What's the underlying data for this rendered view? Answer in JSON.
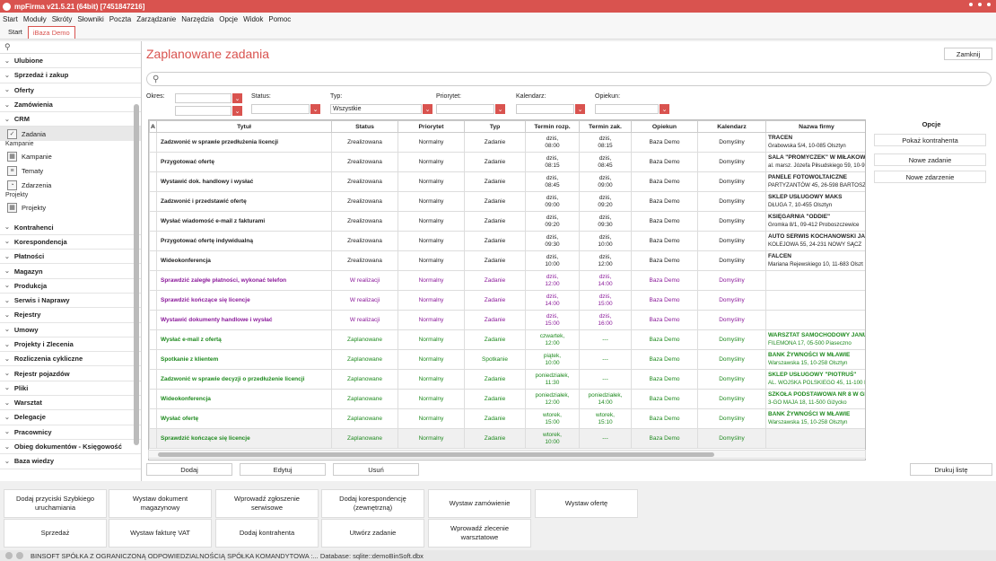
{
  "window": {
    "title": "mpFirma v21.5.21 (64bit) [7451847216]"
  },
  "menu": [
    "Start",
    "Moduły",
    "Skróty",
    "Słowniki",
    "Poczta",
    "Zarządzanie",
    "Narzędzia",
    "Opcje",
    "Widok",
    "Pomoc"
  ],
  "tabs": [
    "Start",
    "iBaza Demo"
  ],
  "sidebar": {
    "top": [
      "Ulubione",
      "Sprzedaż i zakup",
      "Oferty",
      "Zamówienia",
      "CRM"
    ],
    "crm_sub": "Zadania",
    "cat1": "Kampanie",
    "cat1_items": [
      "Kampanie",
      "Tematy",
      "Zdarzenia"
    ],
    "cat2": "Projekty",
    "cat2_items": [
      "Projekty"
    ],
    "bottom": [
      "Kontrahenci",
      "Korespondencja",
      "Płatności",
      "Magazyn",
      "Produkcja",
      "Serwis i Naprawy",
      "Rejestry",
      "Umowy",
      "Projekty i Zlecenia",
      "Rozliczenia cykliczne",
      "Rejestr pojazdów",
      "Pliki",
      "Warsztat",
      "Delegacje",
      "Pracownicy",
      "Obieg dokumentów - Księgowość",
      "Baza wiedzy"
    ]
  },
  "main": {
    "title": "Zaplanowane zadania",
    "close": "Zamknij",
    "filters": {
      "okres": "Okres:",
      "status": "Status:",
      "typ": "Typ:",
      "typ_value": "Wszystkie",
      "priorytet": "Priorytet:",
      "kalendarz": "Kalendarz:",
      "opiekun": "Opiekun:"
    },
    "columns": [
      "A",
      "Tytuł",
      "Status",
      "Priorytet",
      "Typ",
      "Termin rozp.",
      "Termin zak.",
      "Opiekun",
      "Kalendarz",
      "Nazwa firmy"
    ],
    "rows": [
      {
        "kind": "done",
        "title": "Zadzwonić w sprawie przedłużenia licencji",
        "status": "Zrealizowana",
        "prio": "Normalny",
        "typ": "Zadanie",
        "start1": "dziś,",
        "start2": "08:00",
        "end1": "dziś,",
        "end2": "08:15",
        "owner": "Baza Demo",
        "cal": "Domyślny",
        "firm1": "TRACEN",
        "firm2": "Grabowska 5/4, 10-085 Olsztyn"
      },
      {
        "kind": "done",
        "title": "Przygotować ofertę",
        "status": "Zrealizowana",
        "prio": "Normalny",
        "typ": "Zadanie",
        "start1": "dziś,",
        "start2": "08:15",
        "end1": "dziś,",
        "end2": "08:45",
        "owner": "Baza Demo",
        "cal": "Domyślny",
        "firm1": "SALA \"PROMYCZEK\" W MIŁAKOWI",
        "firm2": "al. marsz. Józefa Piłsudskiego 59, 10-9"
      },
      {
        "kind": "done",
        "title": "Wystawić dok. handlowy i wysłać",
        "status": "Zrealizowana",
        "prio": "Normalny",
        "typ": "Zadanie",
        "start1": "dziś,",
        "start2": "08:45",
        "end1": "dziś,",
        "end2": "09:00",
        "owner": "Baza Demo",
        "cal": "Domyślny",
        "firm1": "PANELE FOTOWOLTAICZNE",
        "firm2": "PARTYZANTÓW 45, 26-598 BARTOSZ"
      },
      {
        "kind": "done",
        "title": "Zadzwonić i przedstawić ofertę",
        "status": "Zrealizowana",
        "prio": "Normalny",
        "typ": "Zadanie",
        "start1": "dziś,",
        "start2": "09:00",
        "end1": "dziś,",
        "end2": "09:20",
        "owner": "Baza Demo",
        "cal": "Domyślny",
        "firm1": "SKLEP USŁUGOWY MAKS",
        "firm2": "DŁUGA 7, 10-455 Olsztyn"
      },
      {
        "kind": "done",
        "title": "Wysłać wiadomość e-mail z fakturami",
        "status": "Zrealizowana",
        "prio": "Normalny",
        "typ": "Zadanie",
        "start1": "dziś,",
        "start2": "09:20",
        "end1": "dziś,",
        "end2": "09:30",
        "owner": "Baza Demo",
        "cal": "Domyślny",
        "firm1": "KSIĘGARNIA \"ODDIE\"",
        "firm2": "Gromka 8/1, 09-412 Proboszczewice"
      },
      {
        "kind": "done",
        "title": "Przygotować ofertę indywidualną",
        "status": "Zrealizowana",
        "prio": "Normalny",
        "typ": "Zadanie",
        "start1": "dziś,",
        "start2": "09:30",
        "end1": "dziś,",
        "end2": "10:00",
        "owner": "Baza Demo",
        "cal": "Domyślny",
        "firm1": "AUTO SERWIS KOCHANOWSKI JAN",
        "firm2": "KOLEJOWA 55, 24-231 NOWY SĄCZ"
      },
      {
        "kind": "done",
        "title": "Wideokonferencja",
        "status": "Zrealizowana",
        "prio": "Normalny",
        "typ": "Zadanie",
        "start1": "dziś,",
        "start2": "10:00",
        "end1": "dziś,",
        "end2": "12:00",
        "owner": "Baza Demo",
        "cal": "Domyślny",
        "firm1": "FALCEN",
        "firm2": "Mariana Rejewskiego 10, 11-683 Olszt"
      },
      {
        "kind": "prog",
        "title": "Sprawdzić zaległe płatności, wykonać telefon",
        "status": "W realizacji",
        "prio": "Normalny",
        "typ": "Zadanie",
        "start1": "dziś,",
        "start2": "12:00",
        "end1": "dziś,",
        "end2": "14:00",
        "owner": "Baza Demo",
        "cal": "Domyślny",
        "firm1": "",
        "firm2": ""
      },
      {
        "kind": "prog",
        "title": "Sprawdzić kończące się licencje",
        "status": "W realizacji",
        "prio": "Normalny",
        "typ": "Zadanie",
        "start1": "dziś,",
        "start2": "14:00",
        "end1": "dziś,",
        "end2": "15:00",
        "owner": "Baza Demo",
        "cal": "Domyślny",
        "firm1": "",
        "firm2": ""
      },
      {
        "kind": "prog",
        "title": "Wystawić dokumenty handlowe i wysłać",
        "status": "W realizacji",
        "prio": "Normalny",
        "typ": "Zadanie",
        "start1": "dziś,",
        "start2": "15:00",
        "end1": "dziś,",
        "end2": "16:00",
        "owner": "Baza Demo",
        "cal": "Domyślny",
        "firm1": "",
        "firm2": ""
      },
      {
        "kind": "plan",
        "title": "Wysłać e-mail z ofertą",
        "status": "Zaplanowane",
        "prio": "Normalny",
        "typ": "Zadanie",
        "start1": "czwartek,",
        "start2": "12:00",
        "end1": "---",
        "end2": "",
        "owner": "Baza Demo",
        "cal": "Domyślny",
        "firm1": "WARSZTAT SAMOCHODOWY JANU",
        "firm2": "FILEMONA 17, 05-500 Piaseczno"
      },
      {
        "kind": "plan",
        "title": "Spotkanie z klientem",
        "status": "Zaplanowane",
        "prio": "Normalny",
        "typ": "Spotkanie",
        "start1": "piątek,",
        "start2": "10:00",
        "end1": "---",
        "end2": "",
        "owner": "Baza Demo",
        "cal": "Domyślny",
        "firm1": "BANK ŻYWNOŚCI W MŁAWIE",
        "firm2": "Warszawska 15, 10-258 Olsztyn"
      },
      {
        "kind": "plan",
        "title": "Zadzwonić w sprawie decyzji o przedłużenie licencji",
        "status": "Zaplanowane",
        "prio": "Normalny",
        "typ": "Zadanie",
        "start1": "poniedziałek,",
        "start2": "11:30",
        "end1": "---",
        "end2": "",
        "owner": "Baza Demo",
        "cal": "Domyślny",
        "firm1": "SKLEP USŁUGOWY \"PIOTRUŚ\"",
        "firm2": "AL. WOJSKA POLSKIEGO 45, 11-100 L"
      },
      {
        "kind": "plan",
        "title": "Wideokonferencja",
        "status": "Zaplanowane",
        "prio": "Normalny",
        "typ": "Zadanie",
        "start1": "poniedziałek,",
        "start2": "12:00",
        "end1": "poniedziałek,",
        "end2": "14:00",
        "owner": "Baza Demo",
        "cal": "Domyślny",
        "firm1": "SZKOŁA PODSTAWOWA NR 8 W GI",
        "firm2": "3-GO MAJA 18, 11-500 Giżycko"
      },
      {
        "kind": "plan",
        "title": "Wysłać ofertę",
        "status": "Zaplanowane",
        "prio": "Normalny",
        "typ": "Zadanie",
        "start1": "wtorek,",
        "start2": "15:00",
        "end1": "wtorek,",
        "end2": "15:10",
        "owner": "Baza Demo",
        "cal": "Domyślny",
        "firm1": "BANK ŻYWNOŚCI W MŁAWIE",
        "firm2": "Warszawska 15, 10-258 Olsztyn"
      },
      {
        "kind": "plan last",
        "title": "Sprawdzić kończące się licencje",
        "status": "Zaplanowane",
        "prio": "Normalny",
        "typ": "Zadanie",
        "start1": "wtorek,",
        "start2": "10:00",
        "end1": "---",
        "end2": "",
        "owner": "Baza Demo",
        "cal": "Domyślny",
        "firm1": "",
        "firm2": ""
      }
    ],
    "options_title": "Opcje",
    "options": [
      "Pokaż kontrahenta",
      "Nowe zadanie",
      "Nowe zdarzenie"
    ],
    "actions": [
      "Dodaj",
      "Edytuj",
      "Usuń"
    ],
    "print": "Drukuj listę"
  },
  "quick": [
    [
      "Dodaj przyciski Szybkiego uruchamiania",
      "Wystaw dokument magazynowy",
      "Wprowadź zgłoszenie serwisowe",
      "Dodaj korespondencję (zewnętrzną)",
      "Wystaw zamówienie",
      "Wystaw ofertę"
    ],
    [
      "Sprzedaż",
      "Wystaw fakturę VAT",
      "Dodaj kontrahenta",
      "Utwórz zadanie",
      "Wprowadź zlecenie warsztatowe"
    ]
  ],
  "status": "BINSOFT SPÓŁKA Z OGRANICZONĄ ODPOWIEDZIALNOŚCIĄ SPÓŁKA KOMANDYTOWA :... Database: sqlite::demoBinSoft.dbx"
}
